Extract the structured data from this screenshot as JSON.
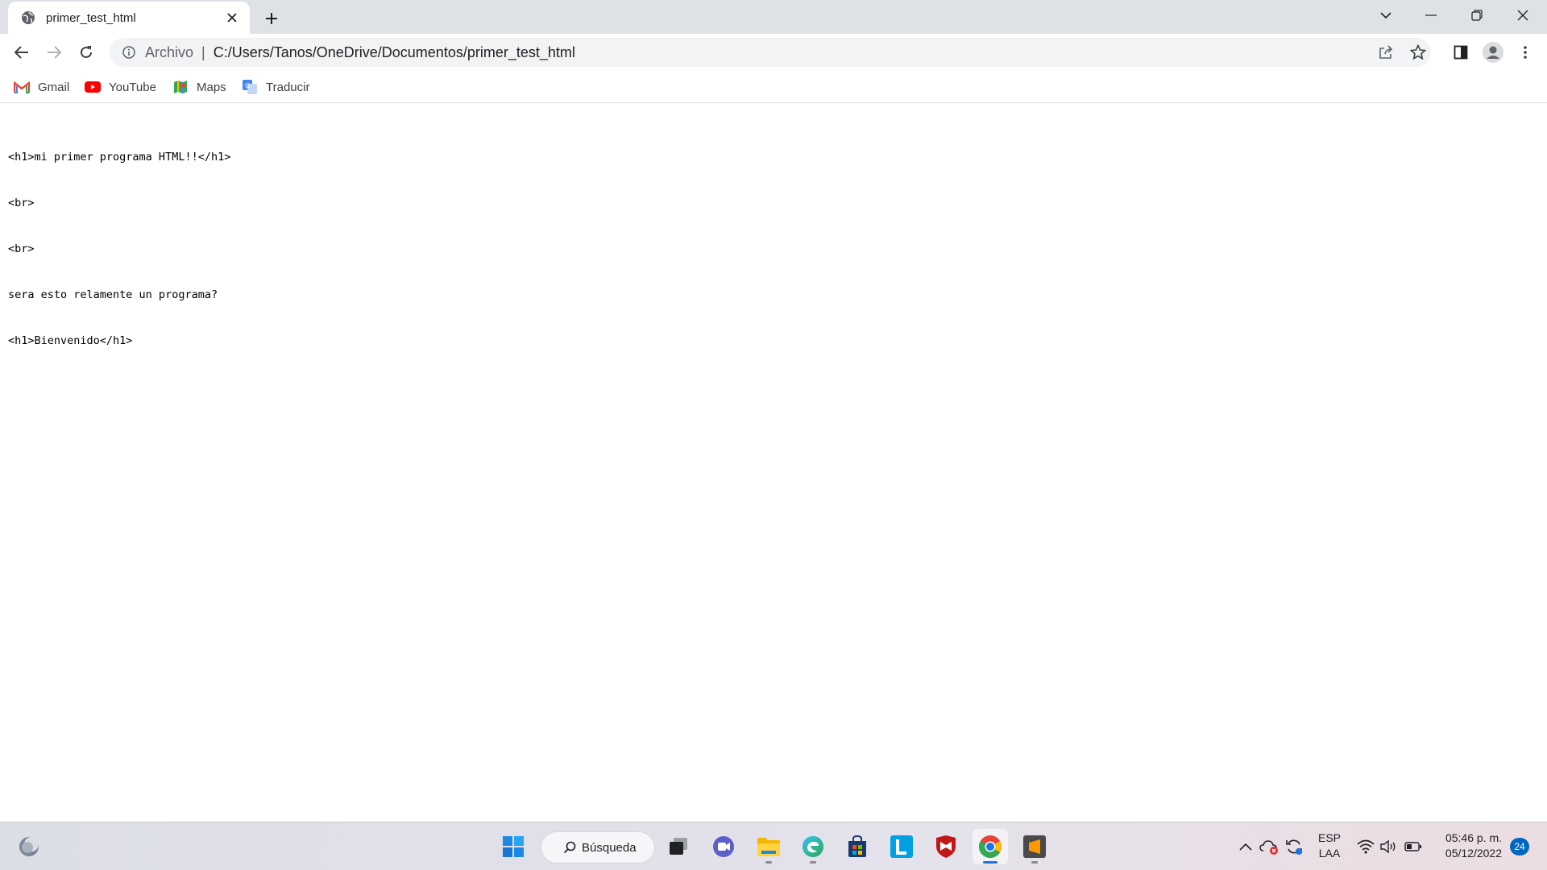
{
  "browser": {
    "tab": {
      "title": "primer_test_html",
      "favicon": "globe-icon"
    },
    "toolbar": {
      "scheme_label": "Archivo",
      "separator": "|",
      "url": "C:/Users/Tanos/OneDrive/Documentos/primer_test_html"
    },
    "bookmarks": [
      {
        "label": "Gmail",
        "icon": "gmail-icon"
      },
      {
        "label": "YouTube",
        "icon": "youtube-icon"
      },
      {
        "label": "Maps",
        "icon": "maps-icon"
      },
      {
        "label": "Traducir",
        "icon": "translate-icon"
      }
    ]
  },
  "page": {
    "source_lines": [
      "<h1>mi primer programa HTML!!</h1>",
      "<br>",
      "<br>",
      "sera esto relamente un programa?",
      "<h1>Bienvenido</h1>"
    ]
  },
  "taskbar": {
    "search_label": "Búsqueda",
    "apps": [
      "windows-start-icon",
      "task-view-icon",
      "chat-icon",
      "file-explorer-icon",
      "edge-icon",
      "store-icon",
      "l-app-icon",
      "mcafee-icon",
      "chrome-icon",
      "sublime-text-icon"
    ],
    "language": {
      "line1": "ESP",
      "line2": "LAA"
    },
    "clock": {
      "time": "05:46 p. m.",
      "date": "05/12/2022"
    },
    "notification_count": "24"
  },
  "colors": {
    "tabstrip_bg": "#dee1e6",
    "chrome_blue": "#1a73e8",
    "youtube_red": "#ff0000",
    "gmail_red": "#ea4335",
    "windows_blue": "#0067c0"
  }
}
